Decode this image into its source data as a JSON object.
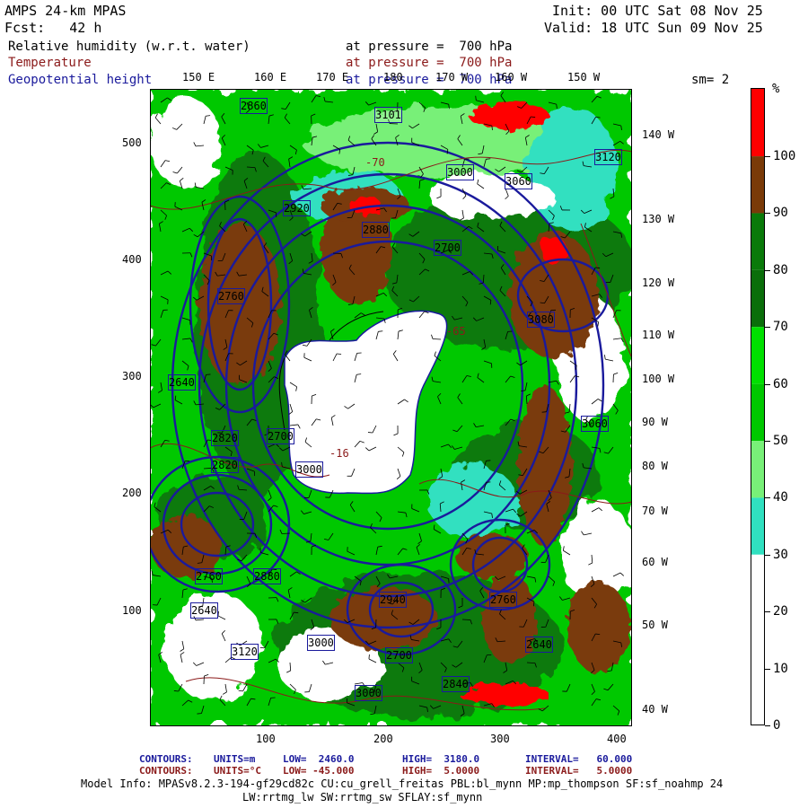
{
  "header": {
    "model": "AMPS 24-km MPAS",
    "forecast": "Fcst:   42 h",
    "init": "Init: 00 UTC Sat 08 Nov 25",
    "valid": "Valid: 18 UTC Sun 09 Nov 25"
  },
  "fields": [
    {
      "name": "Relative humidity (w.r.t. water)",
      "level": "at pressure =  700 hPa",
      "color": "#000000"
    },
    {
      "name": "Temperature",
      "level": "at pressure =  700 hPa",
      "color": "#8b1a1a"
    },
    {
      "name": "Geopotential height",
      "level": "at pressure =  700 hPa",
      "color": "#1a1a9c"
    }
  ],
  "smoothing": "sm= 2",
  "colorbar": {
    "unit": "%",
    "labels": [
      "100",
      "90",
      "80",
      "70",
      "60",
      "50",
      "40",
      "30",
      "20",
      "10",
      "0"
    ],
    "bands": [
      {
        "from": 100,
        "color": "#ff0000"
      },
      {
        "from": 90,
        "color": "#7a3a08"
      },
      {
        "from": 80,
        "color": "#0a7a0a"
      },
      {
        "from": 70,
        "color": "#0a6e0a"
      },
      {
        "from": 60,
        "color": "#00e000"
      },
      {
        "from": 50,
        "color": "#00c800"
      },
      {
        "from": 40,
        "color": "#78f078"
      },
      {
        "from": 30,
        "color": "#30e0c0"
      },
      {
        "from": 0,
        "color": "#ffffff"
      }
    ]
  },
  "axes": {
    "x_ticks": [
      "100",
      "200",
      "300",
      "400"
    ],
    "y_ticks": [
      "500",
      "400",
      "300",
      "200",
      "100"
    ],
    "top_lon_labels": [
      "150 E",
      "160 E",
      "170 E",
      "180",
      "170 W",
      "160 W",
      "150 W"
    ],
    "right_lon_labels": [
      "140 W",
      "130 W",
      "120 W",
      "110 W",
      "100 W",
      "90 W",
      "80 W",
      "70 W",
      "60 W",
      "50 W",
      "40 W"
    ]
  },
  "contour_labels": {
    "height": [
      "3101",
      "2860",
      "3000",
      "3060",
      "2920",
      "2880",
      "2700",
      "2760",
      "2640",
      "2820",
      "3120",
      "3000",
      "2700",
      "3060",
      "2880",
      "2760",
      "2640",
      "2820",
      "3080",
      "2760",
      "2700",
      "2640",
      "3000",
      "3120",
      "2940",
      "2840",
      "3000"
    ],
    "temperature": [
      "-16",
      "-70",
      "-65"
    ]
  },
  "footer": {
    "height_contours": {
      "label": "CONTOURS:",
      "units": "UNITS=m",
      "low": "LOW=  2460.0",
      "high": "HIGH=  3180.0",
      "interval": "INTERVAL=   60.000"
    },
    "temp_contours": {
      "label": "CONTOURS:",
      "units": "UNITS=°C",
      "low": "LOW= -45.000",
      "high": "HIGH=  5.0000",
      "interval": "INTERVAL=   5.0000"
    },
    "model_info_1": "Model Info: MPASv8.2.3-194-gf29cd82c CU:cu_grell_freitas PBL:bl_mynn MP:mp_thompson SF:sf_noahmp 24",
    "model_info_2": "LW:rrtmg_lw SW:rrtmg_sw SFLAY:sf_mynn"
  }
}
